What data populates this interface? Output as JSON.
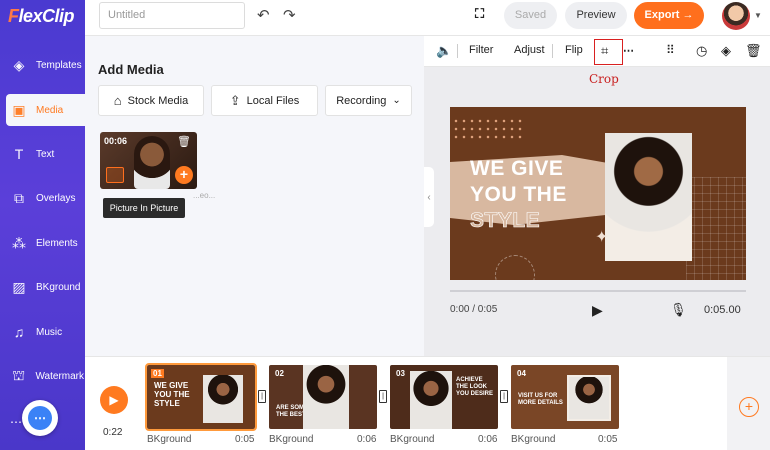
{
  "app": {
    "logo": "FlexClip",
    "accent": "#ff6f1d",
    "sidebar_color": "#4a3ad0"
  },
  "sidebar": {
    "items": [
      {
        "label": "Templates",
        "icon": "layers-icon"
      },
      {
        "label": "Media",
        "icon": "folder-icon",
        "active": true
      },
      {
        "label": "Text",
        "icon": "text-icon"
      },
      {
        "label": "Overlays",
        "icon": "overlays-icon"
      },
      {
        "label": "Elements",
        "icon": "elements-icon"
      },
      {
        "label": "BKground",
        "icon": "background-icon"
      },
      {
        "label": "Music",
        "icon": "music-icon"
      },
      {
        "label": "Watermark",
        "icon": "watermark-icon"
      }
    ]
  },
  "topbar": {
    "title_placeholder": "Untitled",
    "saved_label": "Saved",
    "preview_label": "Preview",
    "export_label": "Export →"
  },
  "media": {
    "title": "Add Media",
    "tabs": [
      "Stock Media",
      "Local Files",
      "Recording"
    ],
    "clip": {
      "duration": "00:06",
      "name": "...eo..."
    },
    "tooltip": "Picture In Picture"
  },
  "toolbar": {
    "filter": "Filter",
    "adjust": "Adjust",
    "flip": "Flip",
    "crop_annotation": "Crop"
  },
  "canvas": {
    "lines": [
      "WE GIVE",
      "YOU THE",
      "STYLE"
    ]
  },
  "player": {
    "current": "0:00 / 0:05",
    "total": "0:05.00",
    "progress": 0
  },
  "timeline": {
    "current_time": "0:22",
    "scenes": [
      {
        "num": "01",
        "text": "WE GIVE YOU THE STYLE",
        "label": "BKground",
        "duration": "0:05"
      },
      {
        "num": "02",
        "text": "ARE SOME OF THE BEST",
        "label": "BKground",
        "duration": "0:06"
      },
      {
        "num": "03",
        "text": "ACHIEVE THE LOOK YOU DESIRE",
        "label": "BKground",
        "duration": "0:06"
      },
      {
        "num": "04",
        "text": "VISIT US FOR MORE DETAILS",
        "label": "BKground",
        "duration": "0:05"
      }
    ]
  }
}
